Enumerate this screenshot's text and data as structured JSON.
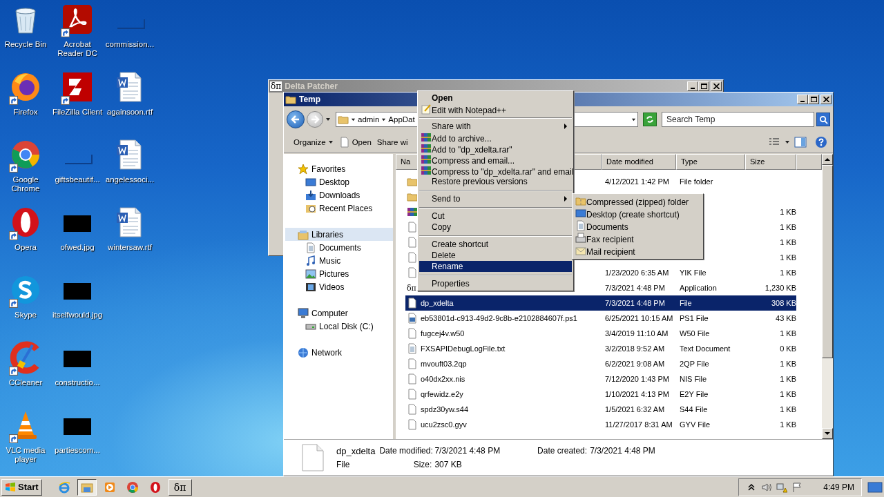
{
  "desktop_icons": [
    {
      "label": "Recycle Bin",
      "kind": "recycle",
      "shortcut": false
    },
    {
      "label": "Firefox",
      "kind": "firefox",
      "shortcut": true
    },
    {
      "label": "Google Chrome",
      "kind": "chrome",
      "shortcut": true
    },
    {
      "label": "Opera",
      "kind": "opera",
      "shortcut": true
    },
    {
      "label": "Skype",
      "kind": "skype",
      "shortcut": true
    },
    {
      "label": "CCleaner",
      "kind": "ccleaner",
      "shortcut": true
    },
    {
      "label": "VLC media player",
      "kind": "vlc",
      "shortcut": true
    },
    {
      "label": "Acrobat Reader DC",
      "kind": "pdf",
      "shortcut": true
    },
    {
      "label": "FileZilla Client",
      "kind": "filezilla",
      "shortcut": true
    },
    {
      "label": "giftsbeautif...",
      "kind": "blank",
      "shortcut": false
    },
    {
      "label": "ofwed.jpg",
      "kind": "image",
      "shortcut": false
    },
    {
      "label": "itselfwould.jpg",
      "kind": "image",
      "shortcut": false
    },
    {
      "label": "constructio...",
      "kind": "image",
      "shortcut": false
    },
    {
      "label": "partiescom...",
      "kind": "image",
      "shortcut": false
    },
    {
      "label": "commission...",
      "kind": "blank",
      "shortcut": false
    },
    {
      "label": "againsoon.rtf",
      "kind": "doc",
      "shortcut": false
    },
    {
      "label": "angelessoci...",
      "kind": "doc",
      "shortcut": false
    },
    {
      "label": "wintersaw.rtf",
      "kind": "doc",
      "shortcut": false
    }
  ],
  "background_window": {
    "icon_text": "δπ",
    "title": "Delta Patcher"
  },
  "explorer": {
    "title": "Temp",
    "breadcrumb": [
      "admin",
      "AppDat"
    ],
    "search": {
      "placeholder": "Search Temp"
    },
    "toolbar": [
      "Organize",
      "Open",
      "Share wi"
    ],
    "navigation": [
      {
        "label": "Favorites",
        "kind": "star",
        "selected": false,
        "children": [
          {
            "label": "Desktop",
            "kind": "desktop",
            "selected": false
          },
          {
            "label": "Downloads",
            "kind": "download",
            "selected": false
          },
          {
            "label": "Recent Places",
            "kind": "recent",
            "selected": false
          }
        ]
      },
      {
        "label": "Libraries",
        "kind": "library",
        "selected": true,
        "children": [
          {
            "label": "Documents",
            "kind": "documents",
            "selected": false
          },
          {
            "label": "Music",
            "kind": "music",
            "selected": false
          },
          {
            "label": "Pictures",
            "kind": "pictures",
            "selected": false
          },
          {
            "label": "Videos",
            "kind": "videos",
            "selected": false
          }
        ]
      },
      {
        "label": "Computer",
        "kind": "computer",
        "selected": false,
        "children": [
          {
            "label": "Local Disk (C:)",
            "kind": "disk",
            "selected": false
          }
        ]
      },
      {
        "label": "Network",
        "kind": "network",
        "selected": false
      }
    ],
    "columns": [
      "Na",
      "Date modified",
      "Type",
      "Size"
    ],
    "rows": [
      {
        "kind": "folder",
        "date": "4/12/2021 1:42 PM",
        "type": "File folder",
        "selected": false
      },
      {
        "kind": "folder",
        "selected": false
      },
      {
        "kind": "rar",
        "size": "1 KB",
        "selected": false
      },
      {
        "kind": "blank",
        "size": "1 KB",
        "selected": false
      },
      {
        "kind": "blank",
        "size": "1 KB",
        "selected": false
      },
      {
        "kind": "blank",
        "size": "1 KB",
        "selected": false
      },
      {
        "kind": "blank",
        "date": "1/23/2020 6:35 AM",
        "type": "YIK File",
        "size": "1 KB",
        "selected": false
      },
      {
        "kind": "app",
        "icon_text": "δπ",
        "date": "7/3/2021 4:48 PM",
        "type": "Application",
        "size": "1,230 KB",
        "selected": false
      },
      {
        "kind": "blank",
        "name": "dp_xdelta",
        "date": "7/3/2021 4:48 PM",
        "type": "File",
        "size": "308 KB",
        "selected": true
      },
      {
        "kind": "script",
        "name": "eb53801d-c913-49d2-9c8b-e2102884607f.ps1",
        "date": "6/25/2021 10:15 AM",
        "type": "PS1 File",
        "size": "43 KB",
        "selected": false
      },
      {
        "kind": "blank",
        "name": "fugcej4v.w50",
        "date": "3/4/2019 11:10 AM",
        "type": "W50 File",
        "size": "1 KB",
        "selected": false
      },
      {
        "kind": "text",
        "name": "FXSAPIDebugLogFile.txt",
        "date": "3/2/2018 9:52 AM",
        "type": "Text Document",
        "size": "0 KB",
        "selected": false
      },
      {
        "kind": "blank",
        "name": "mvouft03.2qp",
        "date": "6/2/2021 9:08 AM",
        "type": "2QP File",
        "size": "1 KB",
        "selected": false
      },
      {
        "kind": "blank",
        "name": "o40dx2xx.nis",
        "date": "7/12/2020 1:43 PM",
        "type": "NIS File",
        "size": "1 KB",
        "selected": false
      },
      {
        "kind": "blank",
        "name": "qrfewidz.e2y",
        "date": "1/10/2021 4:13 PM",
        "type": "E2Y File",
        "size": "1 KB",
        "selected": false
      },
      {
        "kind": "blank",
        "name": "spdz30yw.s44",
        "date": "1/5/2021 6:32 AM",
        "type": "S44 File",
        "size": "1 KB",
        "selected": false
      },
      {
        "kind": "blank",
        "name": "ucu2zsc0.gyv",
        "date": "11/27/2017 8:31 AM",
        "type": "GYV File",
        "size": "1 KB",
        "selected": false
      }
    ],
    "details": {
      "name": "dp_xdelta",
      "type": "File",
      "fields": [
        {
          "label": "Date modified:",
          "value": "7/3/2021 4:48 PM"
        },
        {
          "label": "Date created:",
          "value": "7/3/2021 4:48 PM"
        },
        {
          "label": "Size:",
          "value": "307 KB"
        }
      ]
    }
  },
  "context_menu": [
    {
      "kind": "item",
      "label": "Open",
      "default": true,
      "submenu": false,
      "selected": false
    },
    {
      "kind": "notepad",
      "label": "Edit with Notepad++",
      "default": false,
      "submenu": false,
      "selected": false
    },
    {
      "kind": "separator"
    },
    {
      "kind": "item",
      "label": "Share with",
      "default": false,
      "submenu": true,
      "selected": false
    },
    {
      "kind": "archive",
      "label": "Add to archive...",
      "default": false,
      "submenu": false,
      "selected": false
    },
    {
      "kind": "archive",
      "label": "Add to \"dp_xdelta.rar\"",
      "default": false,
      "submenu": false,
      "selected": false
    },
    {
      "kind": "archive",
      "label": "Compress and email...",
      "default": false,
      "submenu": false,
      "selected": false
    },
    {
      "kind": "archive",
      "label": "Compress to \"dp_xdelta.rar\" and email",
      "default": false,
      "submenu": false,
      "selected": false
    },
    {
      "kind": "item",
      "label": "Restore previous versions",
      "default": false,
      "submenu": false,
      "selected": false
    },
    {
      "kind": "separator"
    },
    {
      "kind": "item",
      "label": "Send to",
      "default": false,
      "submenu": true,
      "selected": false
    },
    {
      "kind": "separator"
    },
    {
      "kind": "item",
      "label": "Cut",
      "default": false,
      "submenu": false,
      "selected": false
    },
    {
      "kind": "item",
      "label": "Copy",
      "default": false,
      "submenu": false,
      "selected": false
    },
    {
      "kind": "separator"
    },
    {
      "kind": "item",
      "label": "Create shortcut",
      "default": false,
      "submenu": false,
      "selected": false
    },
    {
      "kind": "item",
      "label": "Delete",
      "default": false,
      "submenu": false,
      "selected": false
    },
    {
      "kind": "item",
      "label": "Rename",
      "default": false,
      "submenu": false,
      "selected": true
    },
    {
      "kind": "separator"
    },
    {
      "kind": "item",
      "label": "Properties",
      "default": false,
      "submenu": false,
      "selected": false
    }
  ],
  "send_to_menu": [
    {
      "label": "Compressed (zipped) folder",
      "kind": "zip"
    },
    {
      "label": "Desktop (create shortcut)",
      "kind": "desktop"
    },
    {
      "label": "Documents",
      "kind": "documents"
    },
    {
      "label": "Fax recipient",
      "kind": "fax"
    },
    {
      "label": "Mail recipient",
      "kind": "mail"
    }
  ],
  "taskbar": {
    "start": "Start",
    "items": [
      {
        "kind": "ie",
        "active": false
      },
      {
        "kind": "explorer",
        "active": true
      },
      {
        "kind": "media",
        "active": false
      },
      {
        "kind": "chrome",
        "active": false
      },
      {
        "kind": "opera",
        "active": false
      },
      {
        "kind": "app",
        "label": "δπ",
        "active": false
      }
    ],
    "time": "4:49 PM"
  }
}
